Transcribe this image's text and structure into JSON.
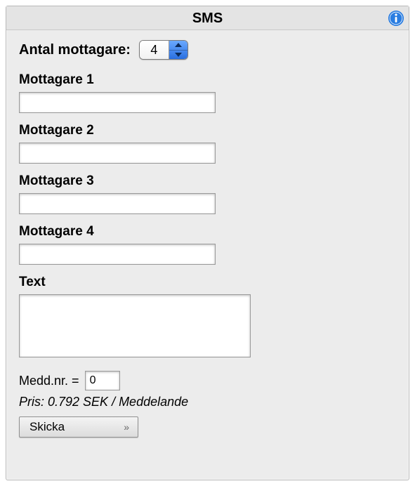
{
  "header": {
    "title": "SMS"
  },
  "count": {
    "label": "Antal mottagare:",
    "value": "4"
  },
  "recipients": [
    {
      "label": "Mottagare 1",
      "value": ""
    },
    {
      "label": "Mottagare 2",
      "value": ""
    },
    {
      "label": "Mottagare 3",
      "value": ""
    },
    {
      "label": "Mottagare 4",
      "value": ""
    }
  ],
  "message": {
    "label": "Text",
    "value": ""
  },
  "meddnr": {
    "label": "Medd.nr. =",
    "value": "0"
  },
  "price": "Pris: 0.792 SEK / Meddelande",
  "send": {
    "label": "Skicka"
  }
}
